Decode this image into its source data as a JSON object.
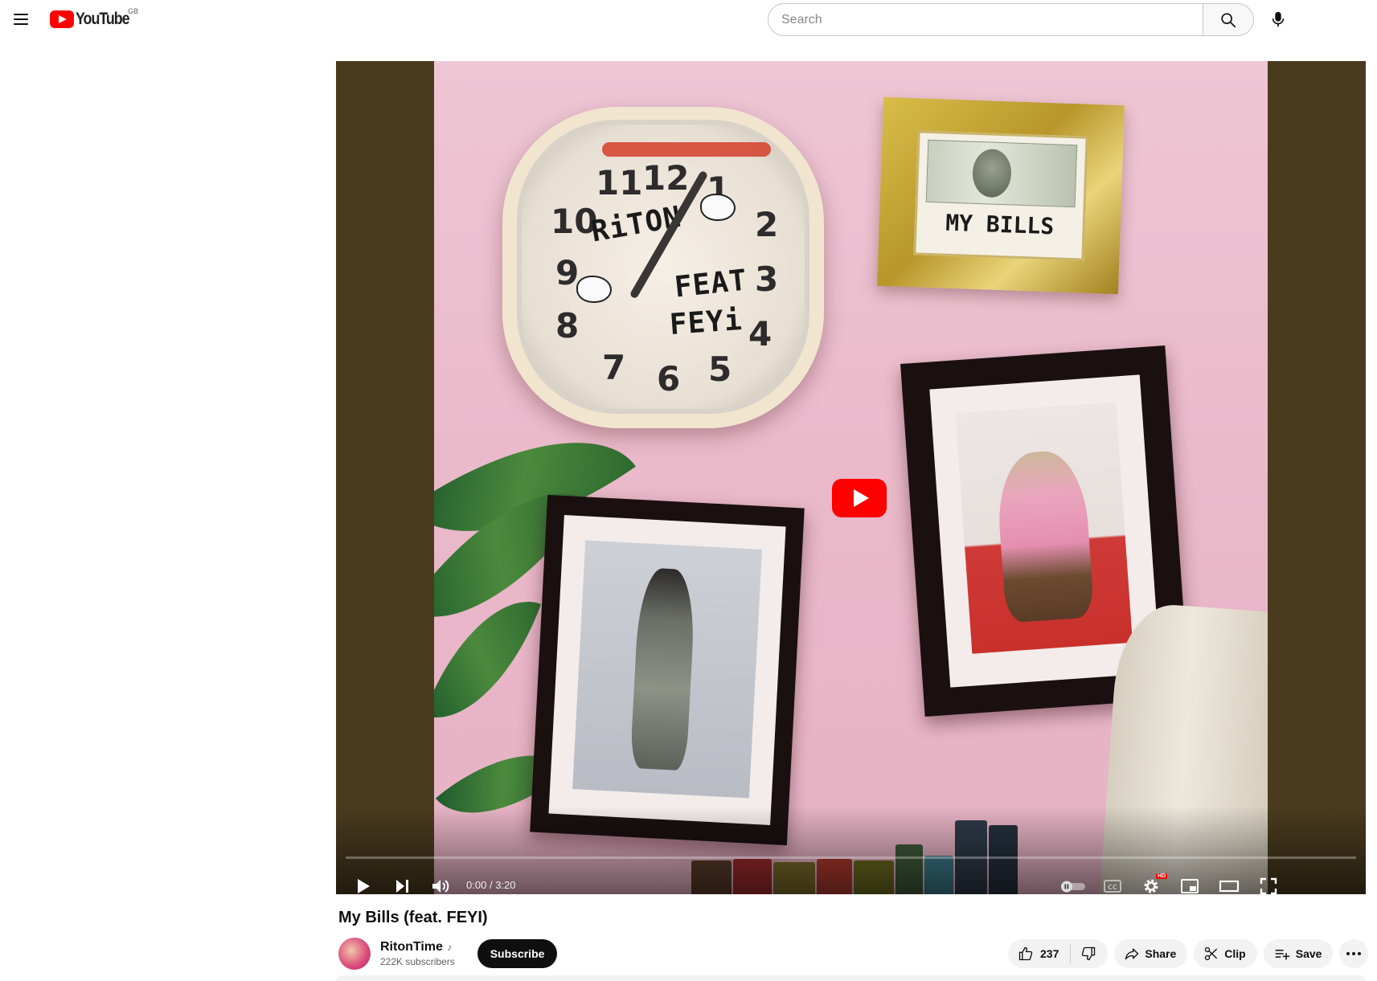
{
  "header": {
    "logo_text": "YouTube",
    "region": "GB",
    "search_placeholder": "Search"
  },
  "player": {
    "artwork": {
      "clock_numbers": [
        "11",
        "12",
        "1",
        "2",
        "3",
        "4",
        "5",
        "6",
        "7",
        "8",
        "9",
        "10"
      ],
      "clock_text_artist": "RiTON",
      "clock_text_feat": "FEAT",
      "clock_text_featured": "FEYi",
      "frame_caption": "MY BILLS"
    },
    "progress_fraction": 0,
    "time_current": "0:00",
    "time_separator": "/",
    "time_total": "3:20",
    "hd_badge": "HD"
  },
  "video": {
    "title": "My Bills (feat. FEYI)"
  },
  "channel": {
    "name": "RitonTime",
    "badge_icon": "music-note-icon",
    "subscribers": "222K subscribers",
    "subscribe_label": "Subscribe"
  },
  "actions": {
    "like_count": "237",
    "share_label": "Share",
    "clip_label": "Clip",
    "save_label": "Save"
  },
  "colors": {
    "brand_red": "#ff0000",
    "player_background": "#4a3b1f",
    "artwork_pink": "#eec6d4",
    "pill_background": "#f2f2f2"
  }
}
